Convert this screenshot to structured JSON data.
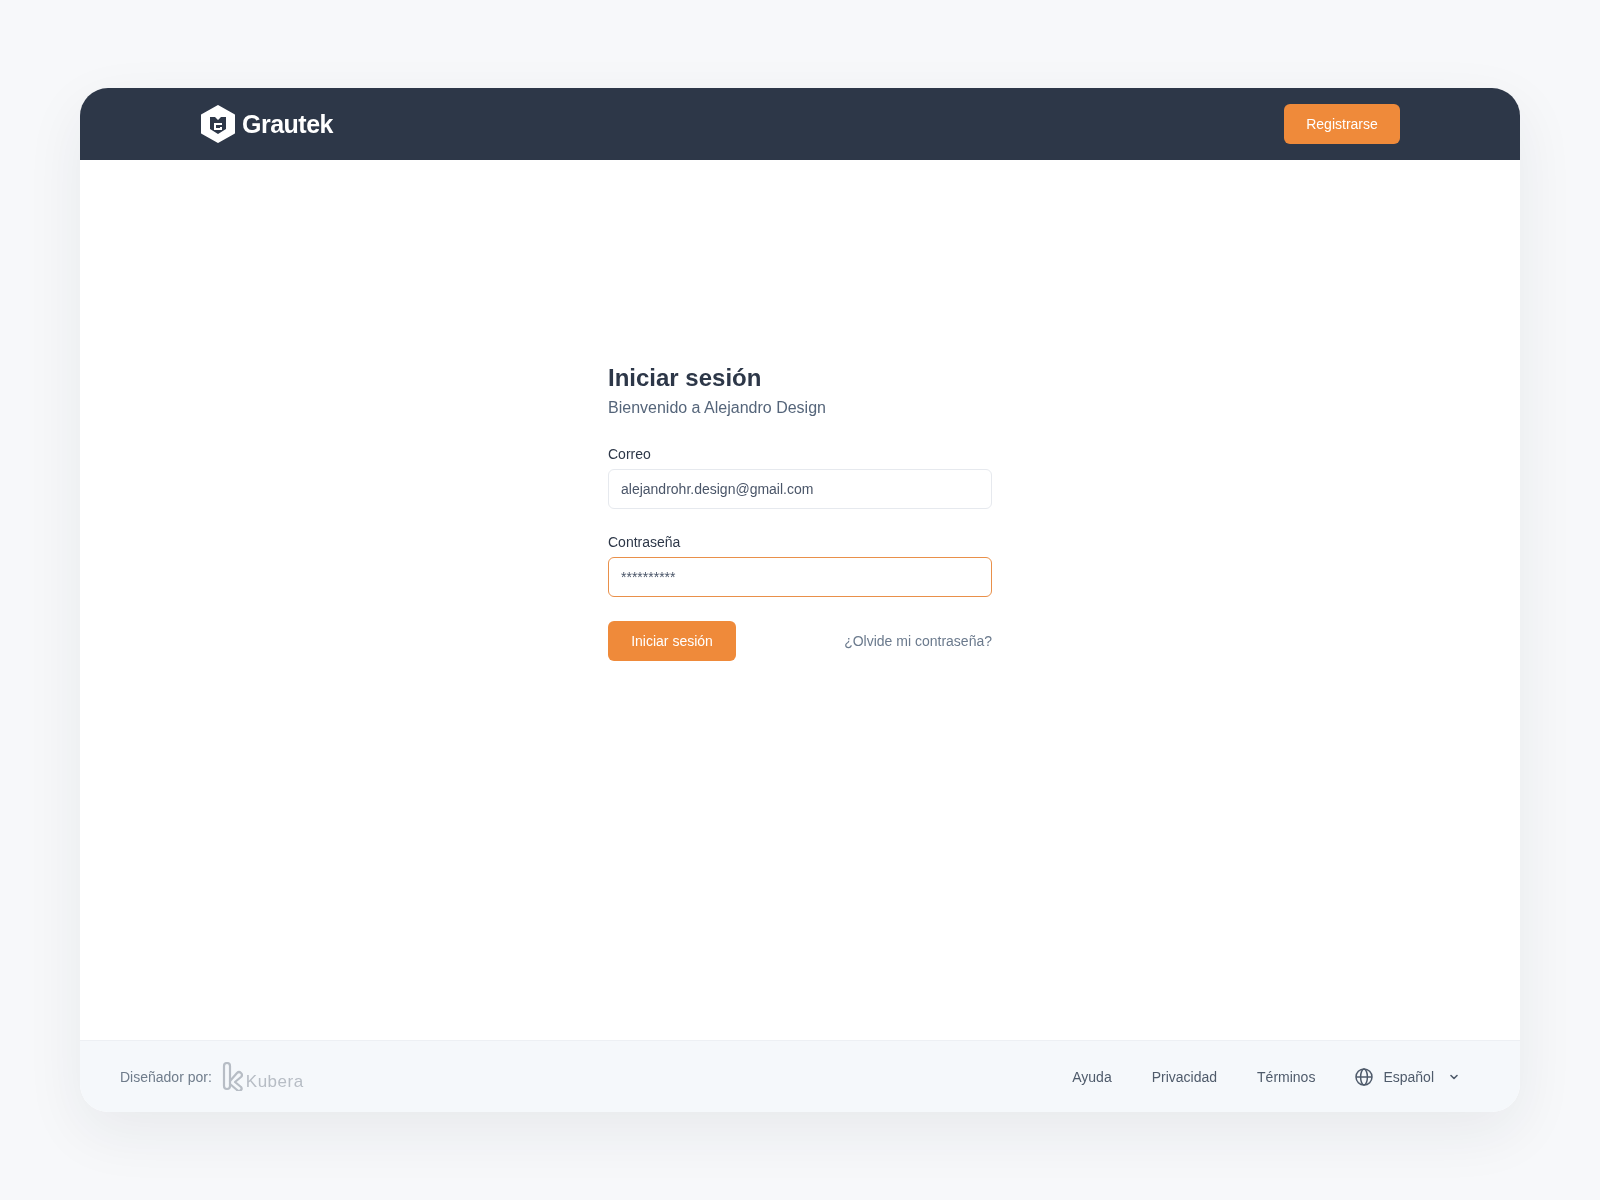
{
  "header": {
    "logo": "Grautek",
    "register_button": "Registrarse"
  },
  "login": {
    "title": "Iniciar sesión",
    "subtitle": "Bienvenido a Alejandro Design",
    "fields": [
      {
        "label": "Correo",
        "value": "alejandrohr.design@gmail.com",
        "focused": false
      },
      {
        "label": "Contraseña",
        "value": "**********",
        "focused": true
      }
    ],
    "submit_button": "Iniciar sesión",
    "forgot_link": "¿Olvide mi contraseña?"
  },
  "footer": {
    "credit_label": "Diseñador por:",
    "credit_brand": "Kubera",
    "links": [
      "Ayuda",
      "Privacidad",
      "Términos"
    ],
    "language": "Español"
  }
}
